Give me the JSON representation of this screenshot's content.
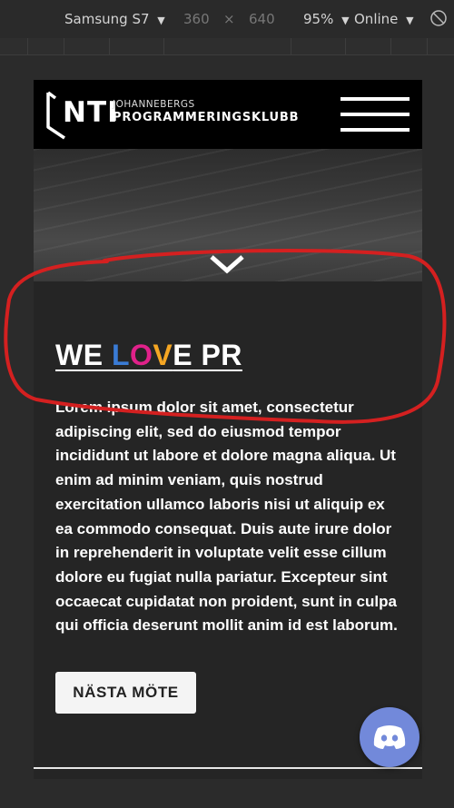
{
  "toolbar": {
    "device": "Samsung S7",
    "width": "360",
    "times": "×",
    "height": "640",
    "zoom": "95%",
    "network": "Online"
  },
  "site": {
    "logo_main": "NTI",
    "logo_line1": "JOHANNEBERGS",
    "logo_line2": "PROGRAMMERINGSKLUBB"
  },
  "content": {
    "headline_parts": [
      {
        "text": "WE ",
        "color": "#ffffff"
      },
      {
        "text": "L",
        "color": "#3a7bd5"
      },
      {
        "text": "O",
        "color": "#e0218a"
      },
      {
        "text": "V",
        "color": "#f5a623"
      },
      {
        "text": "E PR",
        "color": "#ffffff"
      }
    ],
    "body": "Lorem ipsum dolor sit amet, consectetur adipiscing elit, sed do eiusmod tempor incididunt ut labore et dolore magna aliqua. Ut enim ad minim veniam, quis nostrud exercitation ullamco laboris nisi ut aliquip ex ea commodo consequat. Duis aute irure dolor in reprehenderit in voluptate velit esse cillum dolore eu fugiat nulla pariatur. Excepteur sint occaecat cupidatat non proident, sunt in culpa qui officia deserunt mollit anim id est laborum.",
    "cta_label": "NÄSTA MÖTE"
  },
  "colors": {
    "annotation": "#d42020",
    "discord": "#7289da"
  },
  "icons": {
    "device_dropdown": "caret-down-icon",
    "rotate": "rotate-icon",
    "menu": "hamburger-icon",
    "scroll": "chevron-down-icon",
    "chat": "discord-icon"
  }
}
